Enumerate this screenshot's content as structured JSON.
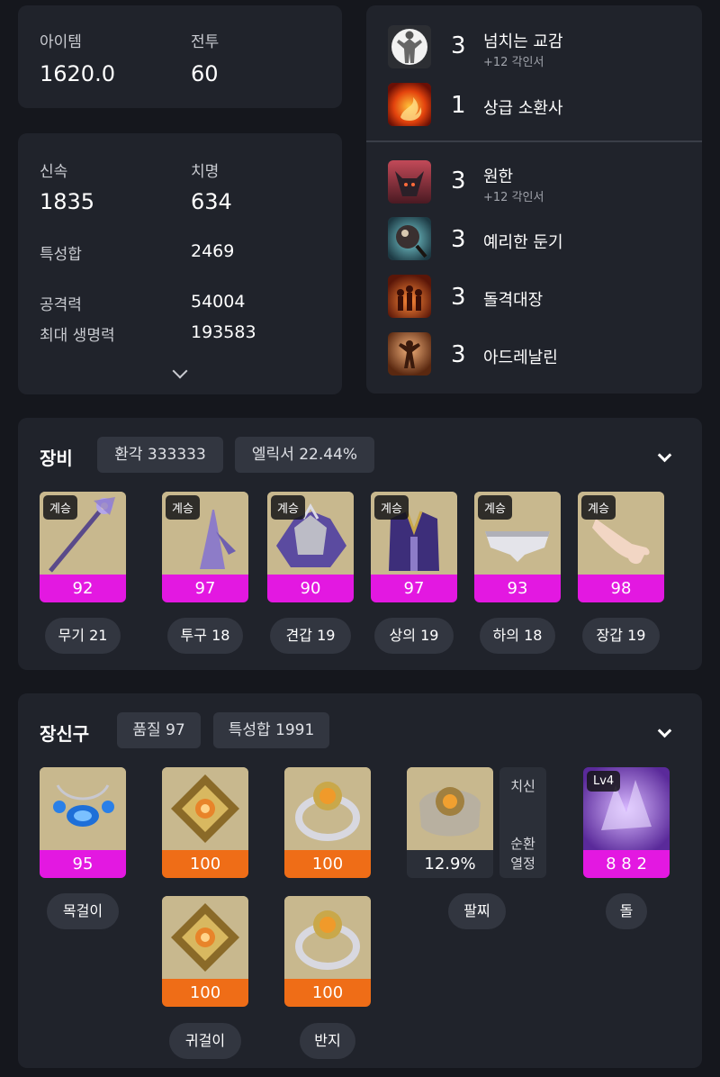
{
  "stats_top": {
    "item_label": "아이템",
    "item_value": "1620.0",
    "combat_label": "전투",
    "combat_value": "60"
  },
  "stats_main": {
    "swift_label": "신속",
    "swift_value": "1835",
    "crit_label": "치명",
    "crit_value": "634",
    "trait_sum_label": "특성합",
    "trait_sum_value": "2469",
    "attack_label": "공격력",
    "attack_value": "54004",
    "hp_label": "최대 생명력",
    "hp_value": "193583"
  },
  "engravings_a": [
    {
      "level": "3",
      "name": "넘치는 교감",
      "sub": "+12 각인서",
      "icon": "figure-icon"
    },
    {
      "level": "1",
      "name": "상급 소환사",
      "sub": "",
      "icon": "phoenix-icon"
    }
  ],
  "engravings_b": [
    {
      "level": "3",
      "name": "원한",
      "sub": "+12 각인서",
      "icon": "demon-icon"
    },
    {
      "level": "3",
      "name": "예리한 둔기",
      "sub": "",
      "icon": "mace-icon"
    },
    {
      "level": "3",
      "name": "돌격대장",
      "sub": "",
      "icon": "charge-icon"
    },
    {
      "level": "3",
      "name": "아드레날린",
      "sub": "",
      "icon": "adrenaline-icon"
    }
  ],
  "equipment": {
    "title": "장비",
    "pill1": "환각 333333",
    "pill2": "엘릭서 22.44%",
    "items": [
      {
        "tag": "계승",
        "quality": "92",
        "label": "무기 21",
        "icon": "staff-icon"
      },
      {
        "tag": "계승",
        "quality": "97",
        "label": "투구 18",
        "icon": "helmet-icon"
      },
      {
        "tag": "계승",
        "quality": "90",
        "label": "견갑 19",
        "icon": "shoulder-icon"
      },
      {
        "tag": "계승",
        "quality": "97",
        "label": "상의 19",
        "icon": "chest-icon"
      },
      {
        "tag": "계승",
        "quality": "93",
        "label": "하의 18",
        "icon": "pants-icon"
      },
      {
        "tag": "계승",
        "quality": "98",
        "label": "장갑 19",
        "icon": "glove-icon"
      }
    ]
  },
  "accessories": {
    "title": "장신구",
    "pill1": "품질 97",
    "pill2": "특성합 1991",
    "necklace": {
      "quality": "95",
      "label": "목걸이",
      "icon": "necklace-icon"
    },
    "earrings": [
      {
        "quality": "100",
        "icon": "earring-icon"
      },
      {
        "quality": "100",
        "icon": "earring-icon"
      }
    ],
    "earring_label": "귀걸이",
    "rings": [
      {
        "quality": "100",
        "icon": "ring-icon"
      },
      {
        "quality": "100",
        "icon": "ring-icon"
      }
    ],
    "ring_label": "반지",
    "bracelet": {
      "value": "12.9%",
      "label": "팔찌",
      "side": [
        "치신",
        "순환",
        "열정"
      ],
      "icon": "bracelet-icon"
    },
    "stone": {
      "tag": "Lv4",
      "value": "8 8 2",
      "label": "돌",
      "icon": "crystal-icon"
    }
  },
  "colors": {
    "quality_magenta": "#e318e1",
    "quality_orange": "#ef6d17",
    "card_bg": "#20232b",
    "page_bg": "#15171d"
  }
}
